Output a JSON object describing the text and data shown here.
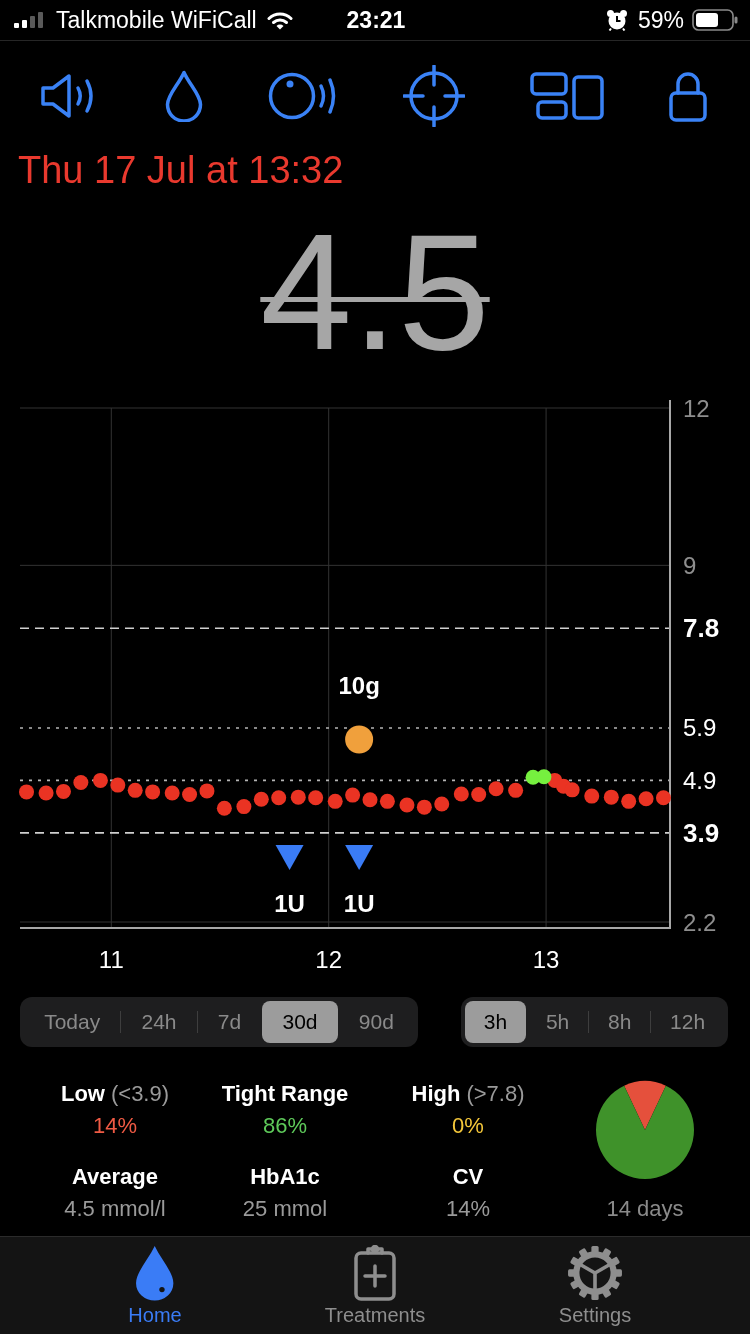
{
  "status_bar": {
    "carrier": "Talkmobile WiFiCall",
    "time": "23:21",
    "battery": "59%"
  },
  "reading": {
    "timestamp": "Thu 17 Jul at 13:32",
    "value": "4.5",
    "stale": true
  },
  "chart": {
    "chart_data": {
      "type": "scatter",
      "xlim": [
        10.58,
        13.57
      ],
      "ylim": [
        2.2,
        12
      ],
      "xticks": [
        11,
        12,
        13
      ],
      "yticks": [
        12,
        9,
        7.8,
        5.9,
        4.9,
        3.9,
        2.2
      ],
      "grid": true,
      "series": [
        {
          "color": "#ea3323",
          "x": [
            10.61,
            10.7,
            10.78,
            10.86,
            10.95,
            11.03,
            11.11,
            11.19,
            11.28,
            11.36,
            11.44,
            11.52,
            11.61,
            11.69,
            11.77,
            11.86,
            11.94,
            12.03,
            12.11,
            12.19,
            12.27,
            12.36,
            12.44,
            12.52,
            12.61,
            12.69,
            12.77,
            12.86,
            13.04,
            13.08,
            13.12,
            13.21,
            13.3,
            13.38,
            13.46,
            13.54
          ],
          "values": [
            4.68,
            4.66,
            4.69,
            4.86,
            4.9,
            4.81,
            4.71,
            4.68,
            4.66,
            4.63,
            4.7,
            4.37,
            4.4,
            4.54,
            4.57,
            4.58,
            4.57,
            4.5,
            4.62,
            4.53,
            4.5,
            4.43,
            4.39,
            4.45,
            4.64,
            4.63,
            4.74,
            4.71,
            4.9,
            4.79,
            4.72,
            4.6,
            4.58,
            4.5,
            4.55,
            4.57
          ]
        },
        {
          "color": "#76f03f",
          "x": [
            12.94,
            12.99
          ],
          "values": [
            4.96,
            4.97
          ]
        },
        {
          "color": "#f0a03c",
          "x": [
            12.14
          ],
          "values": [
            5.68
          ]
        },
        {
          "color": "#3a7cf6",
          "x": [
            11.82,
            12.14
          ],
          "values": [
            3.44,
            3.44
          ]
        }
      ],
      "annotations": [
        "10g",
        "1U",
        "1U"
      ]
    }
  },
  "history_ranges": [
    {
      "label": "Today",
      "selected": false
    },
    {
      "label": "24h",
      "selected": false
    },
    {
      "label": "7d",
      "selected": false
    },
    {
      "label": "30d",
      "selected": true
    },
    {
      "label": "90d",
      "selected": false
    }
  ],
  "chart_windows": [
    {
      "label": "3h",
      "selected": true
    },
    {
      "label": "5h",
      "selected": false
    },
    {
      "label": "8h",
      "selected": false
    },
    {
      "label": "12h",
      "selected": false
    }
  ],
  "stats": {
    "ranges": [
      {
        "label": "Low",
        "range": "(<3.9)",
        "value": "14%",
        "color": "#ef5a44"
      },
      {
        "label": "Tight Range",
        "value": "86%",
        "color": "#5ec95a"
      },
      {
        "label": "High",
        "range": "(>7.8)",
        "value": "0%",
        "color": "#f4c73a"
      }
    ],
    "metrics": [
      {
        "label": "Average",
        "value": "4.5 mmol/l"
      },
      {
        "label": "HbA1c",
        "value": "25 mmol"
      },
      {
        "label": "CV",
        "value": "14%"
      }
    ],
    "pie": {
      "chart_data": {
        "type": "pie",
        "values": [
          14,
          86,
          0
        ]
      },
      "caption": "14 days"
    }
  },
  "tab_bar": [
    {
      "label": "Home",
      "selected": true
    },
    {
      "label": "Treatments",
      "selected": false
    },
    {
      "label": "Settings",
      "selected": false
    }
  ]
}
